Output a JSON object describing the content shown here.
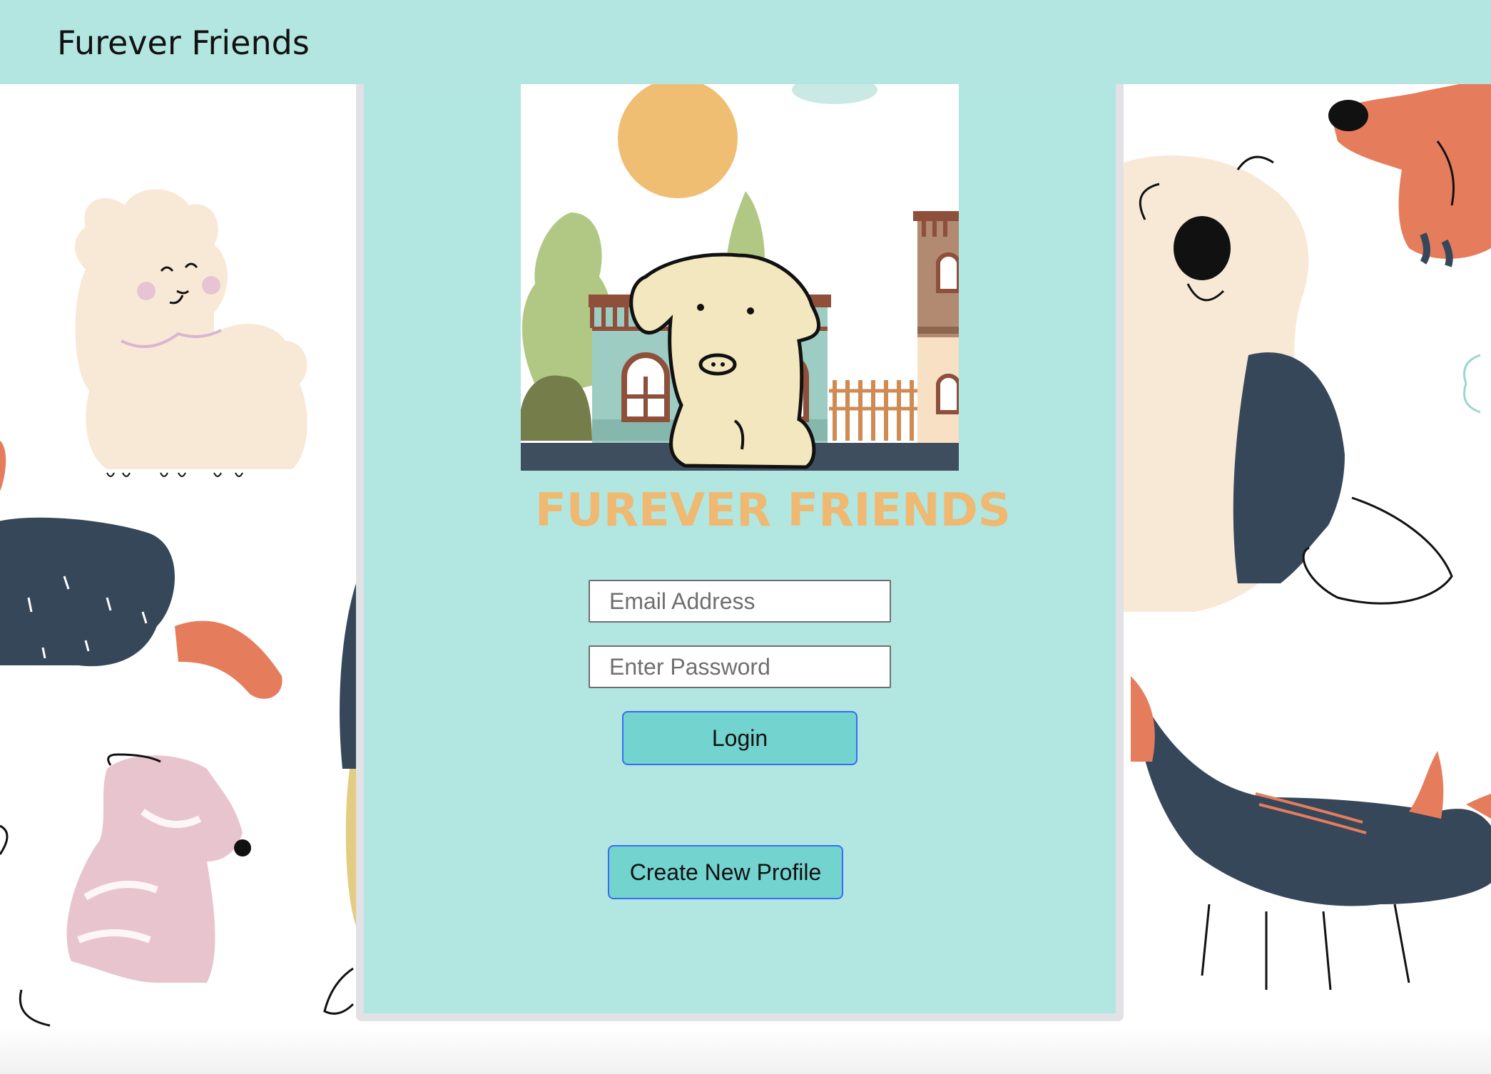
{
  "navbar": {
    "brand": "Furever Friends"
  },
  "hero": {
    "logo_text": "FUREVER FRIENDS"
  },
  "form": {
    "email_placeholder": "Email Address",
    "password_placeholder": "Enter Password",
    "login_label": "Login",
    "create_label": "Create New Profile"
  },
  "colors": {
    "navbar_bg": "#b3e6e0",
    "panel_bg": "#b2e6e0",
    "button_bg": "#73d3cf",
    "button_border": "#3a6cf0",
    "logo_text": "#efb972"
  }
}
